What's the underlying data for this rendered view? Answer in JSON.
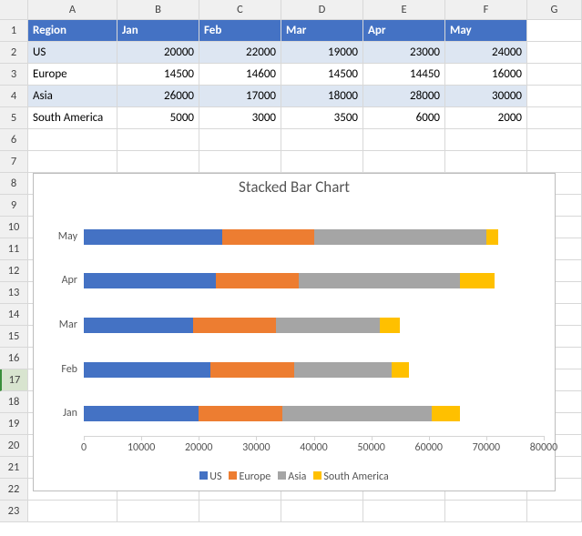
{
  "columns": [
    "A",
    "B",
    "C",
    "D",
    "E",
    "F",
    "G"
  ],
  "rows": [
    "1",
    "2",
    "3",
    "4",
    "5",
    "6",
    "7",
    "8",
    "9",
    "10",
    "11",
    "12",
    "13",
    "14",
    "15",
    "16",
    "17",
    "18",
    "19",
    "20",
    "21",
    "22",
    "23"
  ],
  "table": {
    "headers": {
      "region": "Region",
      "jan": "Jan",
      "feb": "Feb",
      "mar": "Mar",
      "apr": "Apr",
      "may": "May"
    },
    "body": {
      "r0": {
        "name": "US",
        "jan": "20000",
        "feb": "22000",
        "mar": "19000",
        "apr": "23000",
        "may": "24000"
      },
      "r1": {
        "name": "Europe",
        "jan": "14500",
        "feb": "14600",
        "mar": "14500",
        "apr": "14450",
        "may": "16000"
      },
      "r2": {
        "name": "Asia",
        "jan": "26000",
        "feb": "17000",
        "mar": "18000",
        "apr": "28000",
        "may": "30000"
      },
      "r3": {
        "name": "South America",
        "jan": "5000",
        "feb": "3000",
        "mar": "3500",
        "apr": "6000",
        "may": "2000"
      }
    }
  },
  "chart_title": "Stacked Bar Chart",
  "legend": {
    "us": "US",
    "eu": "Europe",
    "as": "Asia",
    "sa": "South America"
  },
  "xticks": {
    "t0": "0",
    "t1": "10000",
    "t2": "20000",
    "t3": "30000",
    "t4": "40000",
    "t5": "50000",
    "t6": "60000",
    "t7": "70000",
    "t8": "80000"
  },
  "yticks": {
    "jan": "Jan",
    "feb": "Feb",
    "mar": "Mar",
    "apr": "Apr",
    "may": "May"
  },
  "chart_data": {
    "type": "bar",
    "orientation": "horizontal",
    "stacked": true,
    "title": "Stacked Bar Chart",
    "xlabel": "",
    "ylabel": "",
    "xlim": [
      0,
      80000
    ],
    "xticks": [
      0,
      10000,
      20000,
      30000,
      40000,
      50000,
      60000,
      70000,
      80000
    ],
    "categories": [
      "Jan",
      "Feb",
      "Mar",
      "Apr",
      "May"
    ],
    "category_display_order": [
      "May",
      "Apr",
      "Mar",
      "Feb",
      "Jan"
    ],
    "series": [
      {
        "name": "US",
        "color": "#4472c4",
        "values": [
          20000,
          22000,
          19000,
          23000,
          24000
        ]
      },
      {
        "name": "Europe",
        "color": "#ed7d31",
        "values": [
          14500,
          14600,
          14500,
          14450,
          16000
        ]
      },
      {
        "name": "Asia",
        "color": "#a5a5a5",
        "values": [
          26000,
          17000,
          18000,
          28000,
          30000
        ]
      },
      {
        "name": "South America",
        "color": "#ffc000",
        "values": [
          5000,
          3000,
          3500,
          6000,
          2000
        ]
      }
    ],
    "legend_position": "bottom",
    "grid": false
  }
}
